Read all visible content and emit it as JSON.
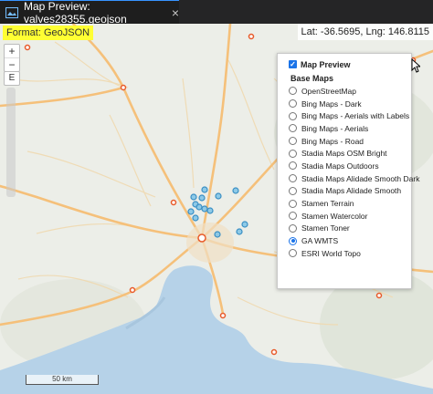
{
  "tab": {
    "title": "Map Preview: valves28355.geojson",
    "close_glyph": "×"
  },
  "map": {
    "format_label": "Format: GeoJSON",
    "coordinate_readout": "Lat: -36.5695, Lng: 146.8115",
    "zoom_in": "+",
    "zoom_out": "−",
    "extent_button": "E",
    "scale_label": "50 km",
    "colors": {
      "feature_fill": "#7ec3e6",
      "feature_stroke": "#3a8fc4",
      "town_marker": "#e85a2a",
      "road": "#f5c07a",
      "water": "#b6d2e8",
      "land": "#eceee8"
    }
  },
  "layer_panel": {
    "overlay_label": "Map Preview",
    "overlay_checked": true,
    "section_title": "Base Maps",
    "base_maps": [
      {
        "label": "OpenStreetMap",
        "checked": false
      },
      {
        "label": "Bing Maps - Dark",
        "checked": false
      },
      {
        "label": "Bing Maps - Aerials with Labels",
        "checked": false
      },
      {
        "label": "Bing Maps - Aerials",
        "checked": false
      },
      {
        "label": "Bing Maps - Road",
        "checked": false
      },
      {
        "label": "Stadia Maps OSM Bright",
        "checked": false
      },
      {
        "label": "Stadia Maps Outdoors",
        "checked": false
      },
      {
        "label": "Stadia Maps Alidade Smooth Dark",
        "checked": false
      },
      {
        "label": "Stadia Maps Alidade Smooth",
        "checked": false
      },
      {
        "label": "Stamen Terrain",
        "checked": false
      },
      {
        "label": "Stamen Watercolor",
        "checked": false
      },
      {
        "label": "Stamen Toner",
        "checked": false
      },
      {
        "label": "GA WMTS",
        "checked": true
      },
      {
        "label": "ESRI World Topo",
        "checked": false
      }
    ]
  }
}
